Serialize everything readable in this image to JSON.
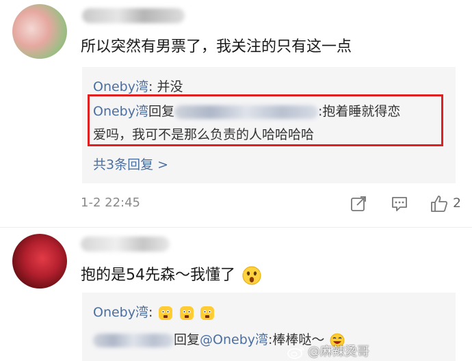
{
  "comments": [
    {
      "text": "所以突然有男票了，我关注的只有这一点",
      "replies": {
        "line1_author": "Oneby湾",
        "line1_text": ": 并没",
        "line2_author": "Oneby湾",
        "line2_reply_word": "回复",
        "line2_text_a": ":抱着睡就得恋",
        "line2_text_b": "爱吗，我可不是那么负责的人哈哈哈哈",
        "more": "共3条回复 >"
      },
      "timestamp": "1-2 22:45",
      "like_count": "2"
    },
    {
      "text": "抱的是54先森～我懂了",
      "replies": {
        "line1_author": "Oneby湾",
        "line1_text": ":",
        "line2_reply_prefix": "回复",
        "line2_mention": "@Oneby湾",
        "line2_text": ":棒棒哒～"
      }
    }
  ],
  "watermark": "@麻辣烫哥",
  "icons": {
    "share": "share-icon",
    "comment": "comment-icon",
    "like": "thumbs-up-icon",
    "weibo": "weibo-logo-icon"
  }
}
